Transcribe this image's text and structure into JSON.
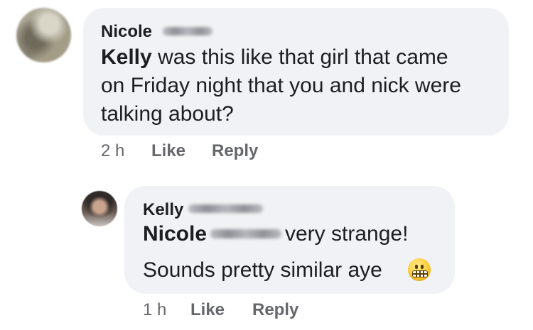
{
  "comment": {
    "author": "Nicole",
    "mention": "Kelly",
    "lines": [
      "was this like that girl that came",
      "on Friday night that you and nick were",
      "talking about?"
    ],
    "timestamp": "2 h",
    "like_label": "Like",
    "reply_label": "Reply"
  },
  "reply": {
    "author": "Kelly",
    "mention": "Nicole",
    "line1": "very strange!",
    "line2": "Sounds pretty similar aye",
    "emoji": "grimacing-face",
    "timestamp": "1 h",
    "like_label": "Like",
    "reply_label": "Reply"
  },
  "colors": {
    "bubble": "#f0f2f5",
    "text": "#1c1e21",
    "meta": "#65676b"
  }
}
